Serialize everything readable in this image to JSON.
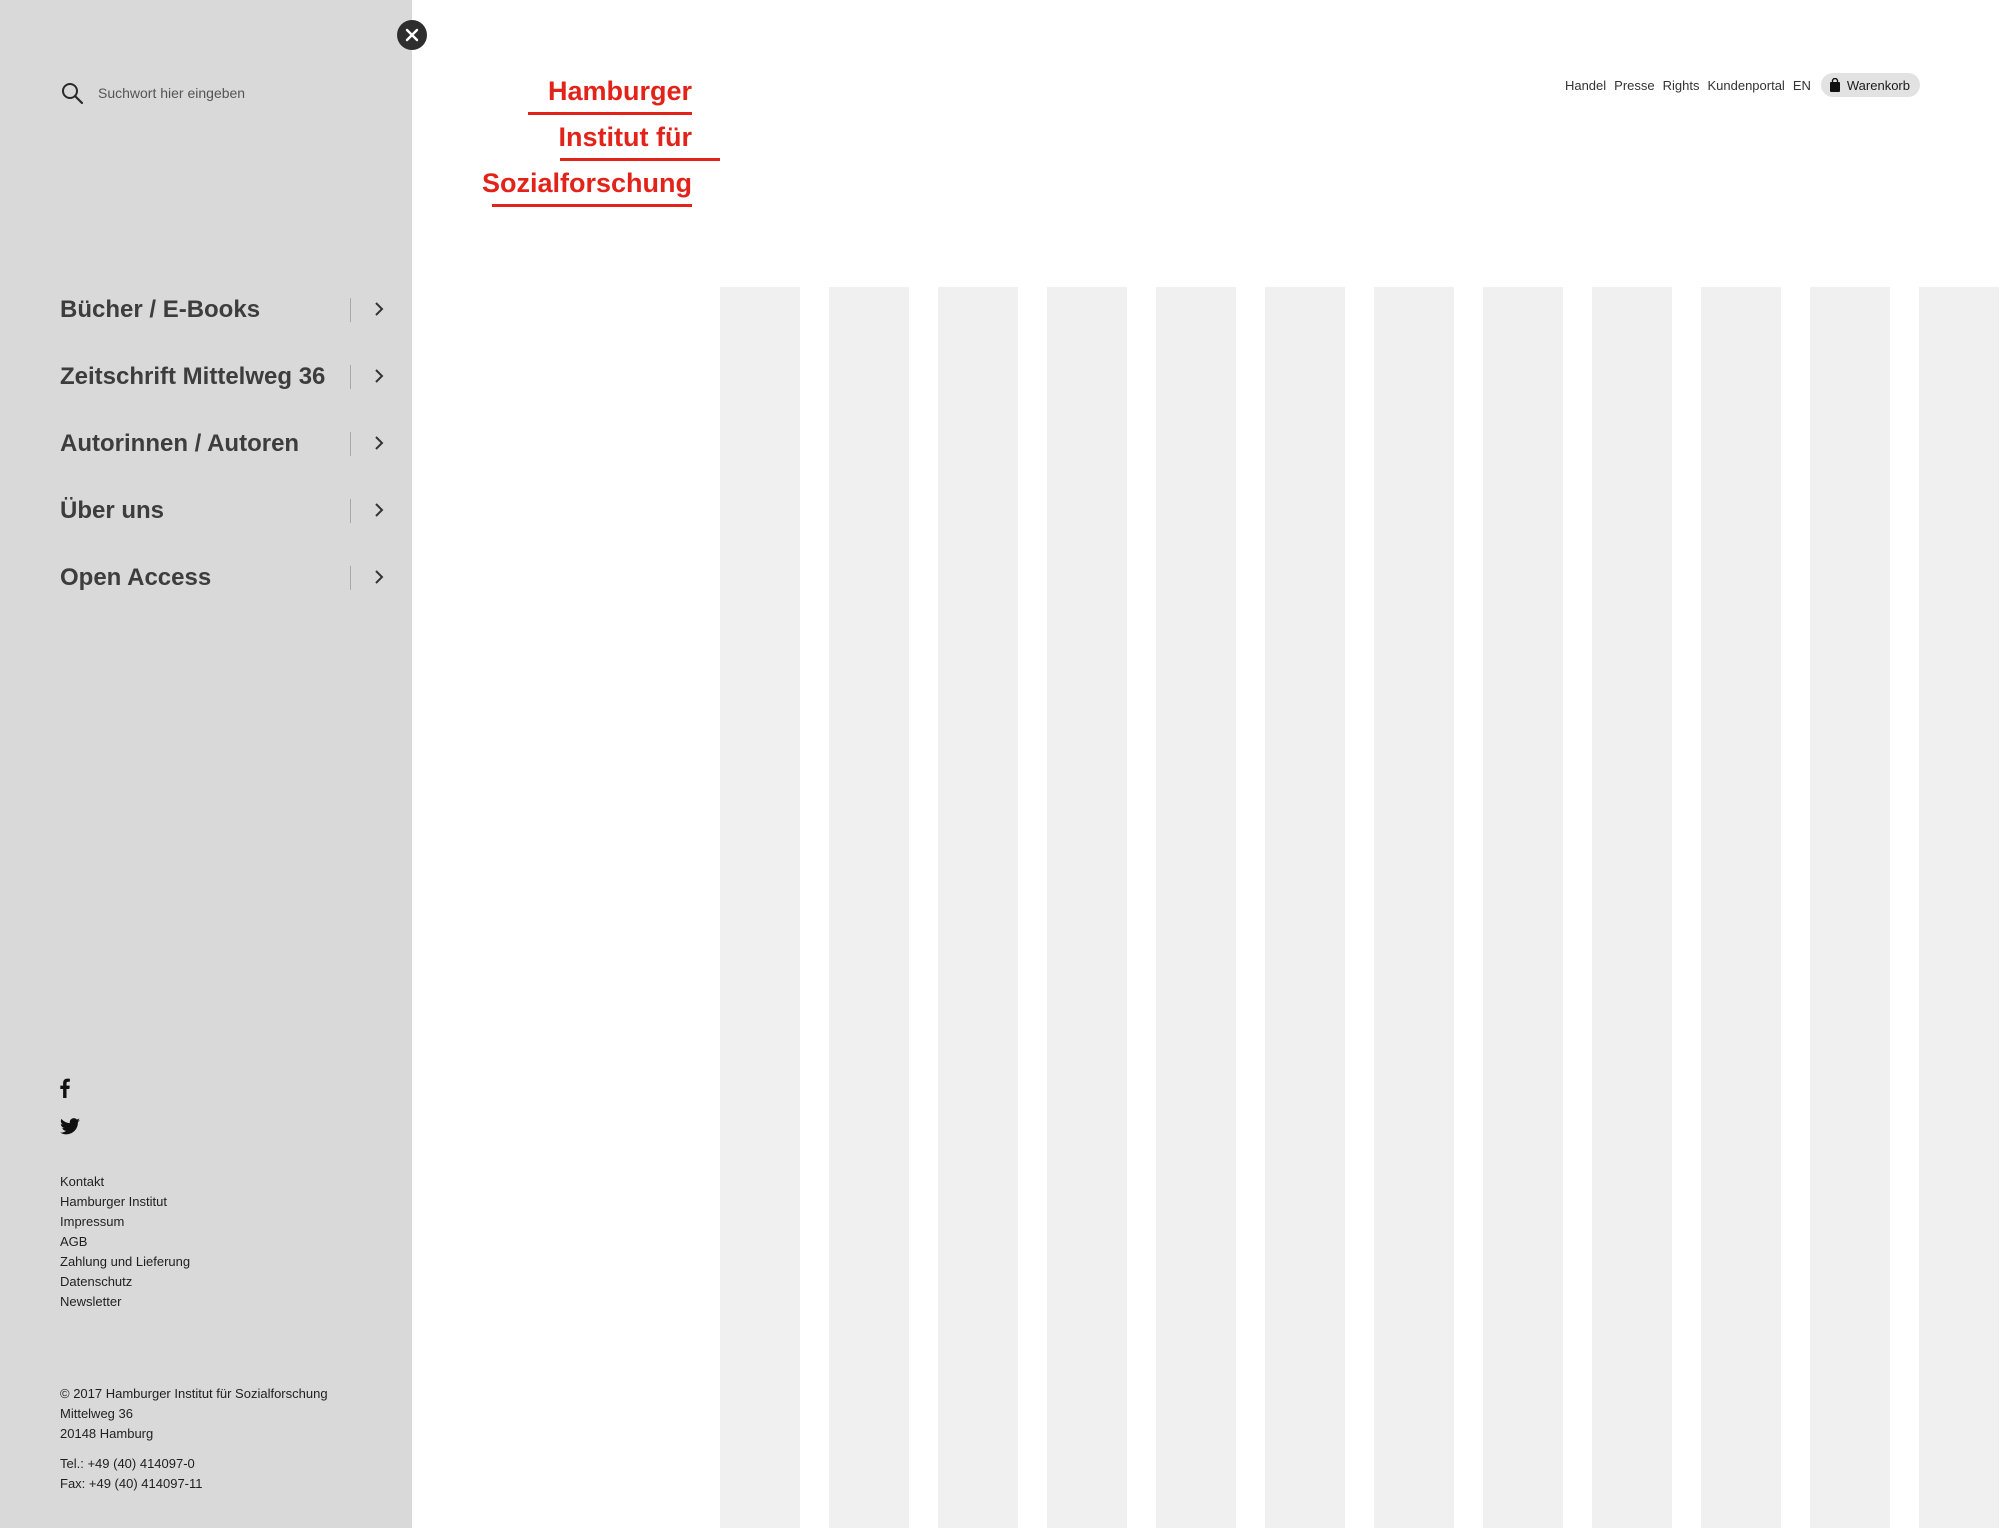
{
  "menu": {
    "close_label": "close",
    "search": {
      "placeholder": "Suchwort hier eingeben"
    },
    "items": [
      {
        "label": "Bücher / E-Books"
      },
      {
        "label": "Zeitschrift Mittelweg 36"
      },
      {
        "label": "Autorinnen / Autoren"
      },
      {
        "label": "Über uns"
      },
      {
        "label": "Open Access"
      }
    ],
    "social": [
      {
        "icon": "facebook-icon"
      },
      {
        "icon": "twitter-icon"
      }
    ],
    "footer_links": [
      "Kontakt",
      "Hamburger Institut",
      "Impressum",
      "AGB",
      "Zahlung und Lieferung",
      "Datenschutz",
      "Newsletter"
    ],
    "address": {
      "copyright": "© 2017 Hamburger Institut für Sozialforschung",
      "street": "Mittelweg 36",
      "city": "20148 Hamburg",
      "tel": "Tel.: +49 (40) 414097-0",
      "fax": "Fax: +49 (40) 414097-11"
    }
  },
  "logo": {
    "line1": "Hamburger",
    "line2": "Institut für",
    "line3": "Sozialforschung",
    "color": "#e2231a"
  },
  "top_nav": {
    "links": [
      "Handel",
      "Presse",
      "Rights",
      "Kundenportal",
      "EN"
    ],
    "cart_label": "Warenkorb"
  },
  "colors": {
    "panel_bg": "#d9d9d9",
    "accent": "#e2231a",
    "grid_column": "#f0f0f0"
  }
}
